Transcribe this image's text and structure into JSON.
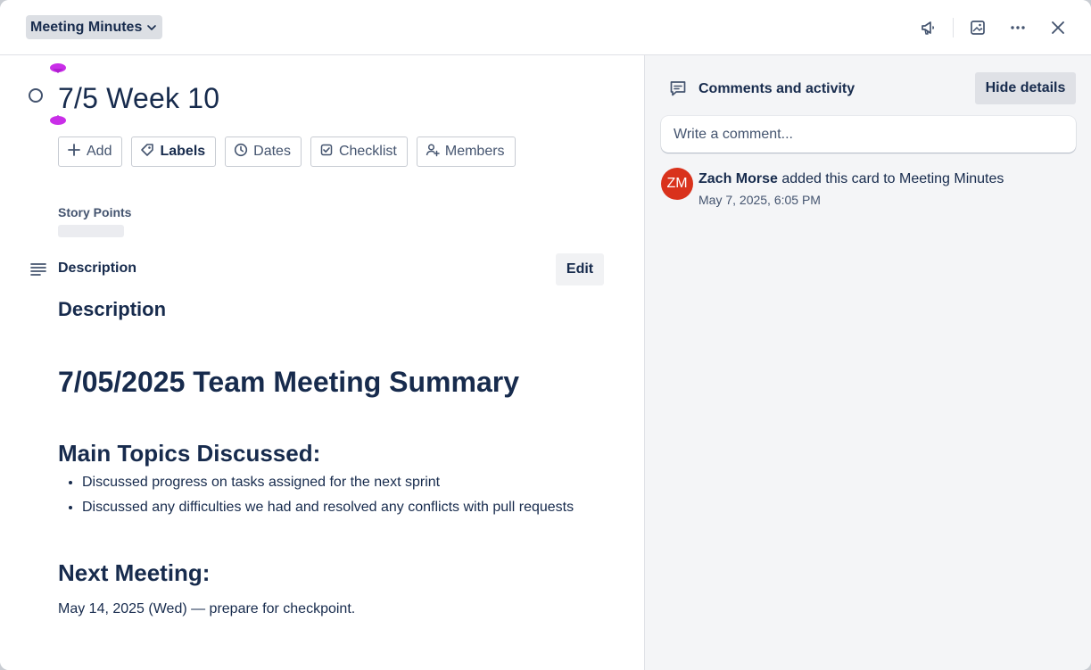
{
  "header": {
    "list_name": "Meeting Minutes",
    "icons": [
      "megaphone-icon",
      "image-icon",
      "more-icon",
      "close-icon"
    ]
  },
  "card": {
    "title": "7/5 Week 10",
    "actions": [
      {
        "label": "Add",
        "icon": "plus-icon"
      },
      {
        "label": "Labels",
        "icon": "tag-icon"
      },
      {
        "label": "Dates",
        "icon": "clock-icon"
      },
      {
        "label": "Checklist",
        "icon": "checkbox-icon"
      },
      {
        "label": "Members",
        "icon": "add-user-icon"
      }
    ],
    "story_points_label": "Story Points",
    "description_heading": "Description",
    "edit_label": "Edit"
  },
  "description": {
    "heading": "Description",
    "summary_heading": "7/05/2025 Team Meeting Summary",
    "topics_heading": "Main Topics Discussed:",
    "topics": [
      "Discussed progress on tasks assigned for the next sprint",
      "Discussed any difficulties we had and resolved any conflicts with pull requests"
    ],
    "next_heading": "Next Meeting:",
    "next_text": "May 14, 2025 (Wed) — prepare for checkpoint."
  },
  "activity": {
    "title": "Comments and activity",
    "hide_label": "Hide details",
    "comment_placeholder": "Write a comment...",
    "entries": [
      {
        "initials": "ZM",
        "user": "Zach Morse",
        "action": " added this card to Meeting Minutes",
        "time": "May 7, 2025, 6:05 PM"
      }
    ]
  },
  "colors": {
    "avatar": "#d9321c",
    "handle": "#c92ee8",
    "text": "#172b4d"
  }
}
